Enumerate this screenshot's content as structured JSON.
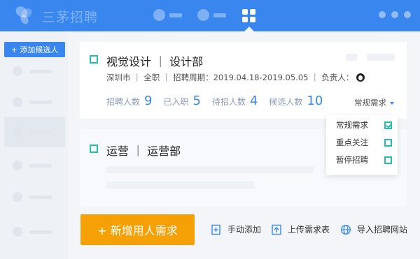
{
  "header": {
    "app_title": "三茅招聘",
    "logo_icon": "bee-logo-icon",
    "accent_color": "#3a86ef"
  },
  "sidebar": {
    "add_candidate_label": "+ 添加候选人"
  },
  "jobs": [
    {
      "title": "视觉设计 ｜ 设计部",
      "meta": "深圳市 ｜ 全职 ｜ 招聘周期：2019.04.18-2019.05.05 ｜ 负责人：",
      "stats": [
        {
          "label": "招聘人数",
          "value": "9"
        },
        {
          "label": "已入职",
          "value": "5"
        },
        {
          "label": "待招人数",
          "value": "4"
        },
        {
          "label": "候选人数",
          "value": "10"
        }
      ],
      "requirement_type": "常规需求"
    },
    {
      "title": "运营 ｜ 运营部"
    }
  ],
  "dropdown": {
    "options": [
      {
        "label": "常规需求",
        "checked": true
      },
      {
        "label": "重点关注",
        "checked": false
      },
      {
        "label": "暂停招聘",
        "checked": false
      }
    ]
  },
  "actions": {
    "primary_label": "+ 新增用人需求",
    "manual_add": "手动添加",
    "upload": "上传需求表",
    "import": "导入招聘网站"
  },
  "colors": {
    "primary": "#3a86ef",
    "orange": "#f5a005",
    "teal": "#26c0a6"
  }
}
